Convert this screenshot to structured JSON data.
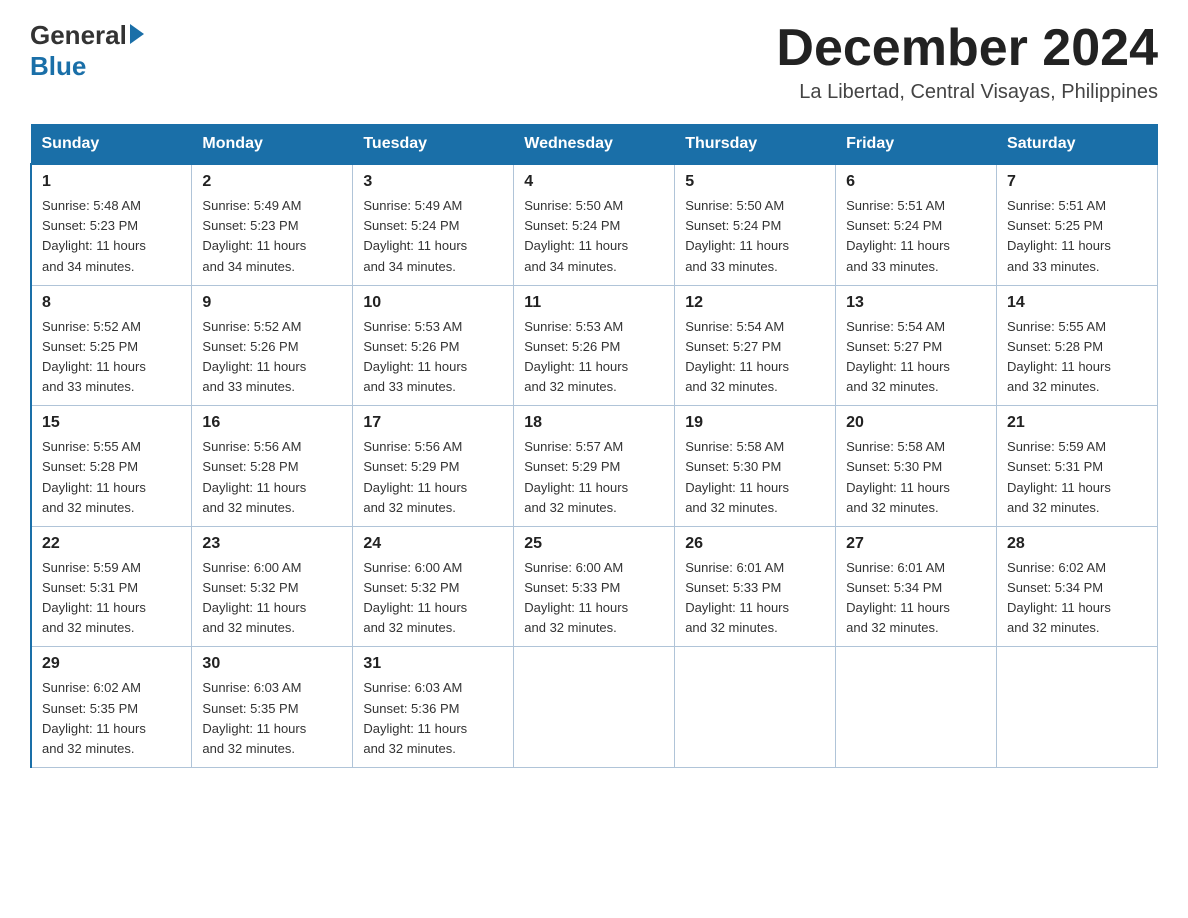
{
  "logo": {
    "general": "General",
    "blue": "Blue"
  },
  "title": "December 2024",
  "location": "La Libertad, Central Visayas, Philippines",
  "days_of_week": [
    "Sunday",
    "Monday",
    "Tuesday",
    "Wednesday",
    "Thursday",
    "Friday",
    "Saturday"
  ],
  "weeks": [
    [
      {
        "day": "1",
        "sunrise": "5:48 AM",
        "sunset": "5:23 PM",
        "daylight": "11 hours and 34 minutes."
      },
      {
        "day": "2",
        "sunrise": "5:49 AM",
        "sunset": "5:23 PM",
        "daylight": "11 hours and 34 minutes."
      },
      {
        "day": "3",
        "sunrise": "5:49 AM",
        "sunset": "5:24 PM",
        "daylight": "11 hours and 34 minutes."
      },
      {
        "day": "4",
        "sunrise": "5:50 AM",
        "sunset": "5:24 PM",
        "daylight": "11 hours and 34 minutes."
      },
      {
        "day": "5",
        "sunrise": "5:50 AM",
        "sunset": "5:24 PM",
        "daylight": "11 hours and 33 minutes."
      },
      {
        "day": "6",
        "sunrise": "5:51 AM",
        "sunset": "5:24 PM",
        "daylight": "11 hours and 33 minutes."
      },
      {
        "day": "7",
        "sunrise": "5:51 AM",
        "sunset": "5:25 PM",
        "daylight": "11 hours and 33 minutes."
      }
    ],
    [
      {
        "day": "8",
        "sunrise": "5:52 AM",
        "sunset": "5:25 PM",
        "daylight": "11 hours and 33 minutes."
      },
      {
        "day": "9",
        "sunrise": "5:52 AM",
        "sunset": "5:26 PM",
        "daylight": "11 hours and 33 minutes."
      },
      {
        "day": "10",
        "sunrise": "5:53 AM",
        "sunset": "5:26 PM",
        "daylight": "11 hours and 33 minutes."
      },
      {
        "day": "11",
        "sunrise": "5:53 AM",
        "sunset": "5:26 PM",
        "daylight": "11 hours and 32 minutes."
      },
      {
        "day": "12",
        "sunrise": "5:54 AM",
        "sunset": "5:27 PM",
        "daylight": "11 hours and 32 minutes."
      },
      {
        "day": "13",
        "sunrise": "5:54 AM",
        "sunset": "5:27 PM",
        "daylight": "11 hours and 32 minutes."
      },
      {
        "day": "14",
        "sunrise": "5:55 AM",
        "sunset": "5:28 PM",
        "daylight": "11 hours and 32 minutes."
      }
    ],
    [
      {
        "day": "15",
        "sunrise": "5:55 AM",
        "sunset": "5:28 PM",
        "daylight": "11 hours and 32 minutes."
      },
      {
        "day": "16",
        "sunrise": "5:56 AM",
        "sunset": "5:28 PM",
        "daylight": "11 hours and 32 minutes."
      },
      {
        "day": "17",
        "sunrise": "5:56 AM",
        "sunset": "5:29 PM",
        "daylight": "11 hours and 32 minutes."
      },
      {
        "day": "18",
        "sunrise": "5:57 AM",
        "sunset": "5:29 PM",
        "daylight": "11 hours and 32 minutes."
      },
      {
        "day": "19",
        "sunrise": "5:58 AM",
        "sunset": "5:30 PM",
        "daylight": "11 hours and 32 minutes."
      },
      {
        "day": "20",
        "sunrise": "5:58 AM",
        "sunset": "5:30 PM",
        "daylight": "11 hours and 32 minutes."
      },
      {
        "day": "21",
        "sunrise": "5:59 AM",
        "sunset": "5:31 PM",
        "daylight": "11 hours and 32 minutes."
      }
    ],
    [
      {
        "day": "22",
        "sunrise": "5:59 AM",
        "sunset": "5:31 PM",
        "daylight": "11 hours and 32 minutes."
      },
      {
        "day": "23",
        "sunrise": "6:00 AM",
        "sunset": "5:32 PM",
        "daylight": "11 hours and 32 minutes."
      },
      {
        "day": "24",
        "sunrise": "6:00 AM",
        "sunset": "5:32 PM",
        "daylight": "11 hours and 32 minutes."
      },
      {
        "day": "25",
        "sunrise": "6:00 AM",
        "sunset": "5:33 PM",
        "daylight": "11 hours and 32 minutes."
      },
      {
        "day": "26",
        "sunrise": "6:01 AM",
        "sunset": "5:33 PM",
        "daylight": "11 hours and 32 minutes."
      },
      {
        "day": "27",
        "sunrise": "6:01 AM",
        "sunset": "5:34 PM",
        "daylight": "11 hours and 32 minutes."
      },
      {
        "day": "28",
        "sunrise": "6:02 AM",
        "sunset": "5:34 PM",
        "daylight": "11 hours and 32 minutes."
      }
    ],
    [
      {
        "day": "29",
        "sunrise": "6:02 AM",
        "sunset": "5:35 PM",
        "daylight": "11 hours and 32 minutes."
      },
      {
        "day": "30",
        "sunrise": "6:03 AM",
        "sunset": "5:35 PM",
        "daylight": "11 hours and 32 minutes."
      },
      {
        "day": "31",
        "sunrise": "6:03 AM",
        "sunset": "5:36 PM",
        "daylight": "11 hours and 32 minutes."
      },
      null,
      null,
      null,
      null
    ]
  ],
  "labels": {
    "sunrise": "Sunrise:",
    "sunset": "Sunset:",
    "daylight": "Daylight:"
  }
}
